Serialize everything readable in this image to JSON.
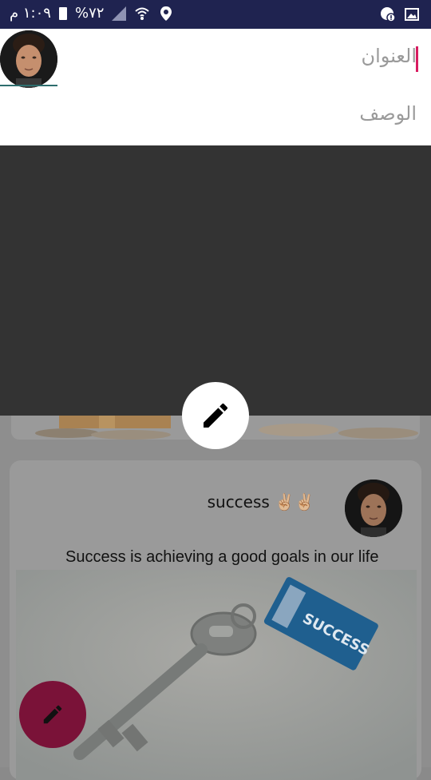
{
  "status_bar": {
    "time": "١:٠٩ م",
    "battery": "%٧٢",
    "icons": [
      "battery-icon",
      "signal-icon",
      "wifi-icon",
      "location-icon",
      "alert-icon",
      "image-icon"
    ]
  },
  "form": {
    "title_placeholder": "العنوان",
    "description_placeholder": "الوصف"
  },
  "post": {
    "title": "success ✌🏼✌🏼",
    "description": "Success is achieving a good goals in our life",
    "image_label": "SUCCESS"
  },
  "colors": {
    "status_bar": "#1f2350",
    "accent": "#d81b60",
    "preview_bg": "#333333",
    "fab_primary": "#7a1238"
  }
}
